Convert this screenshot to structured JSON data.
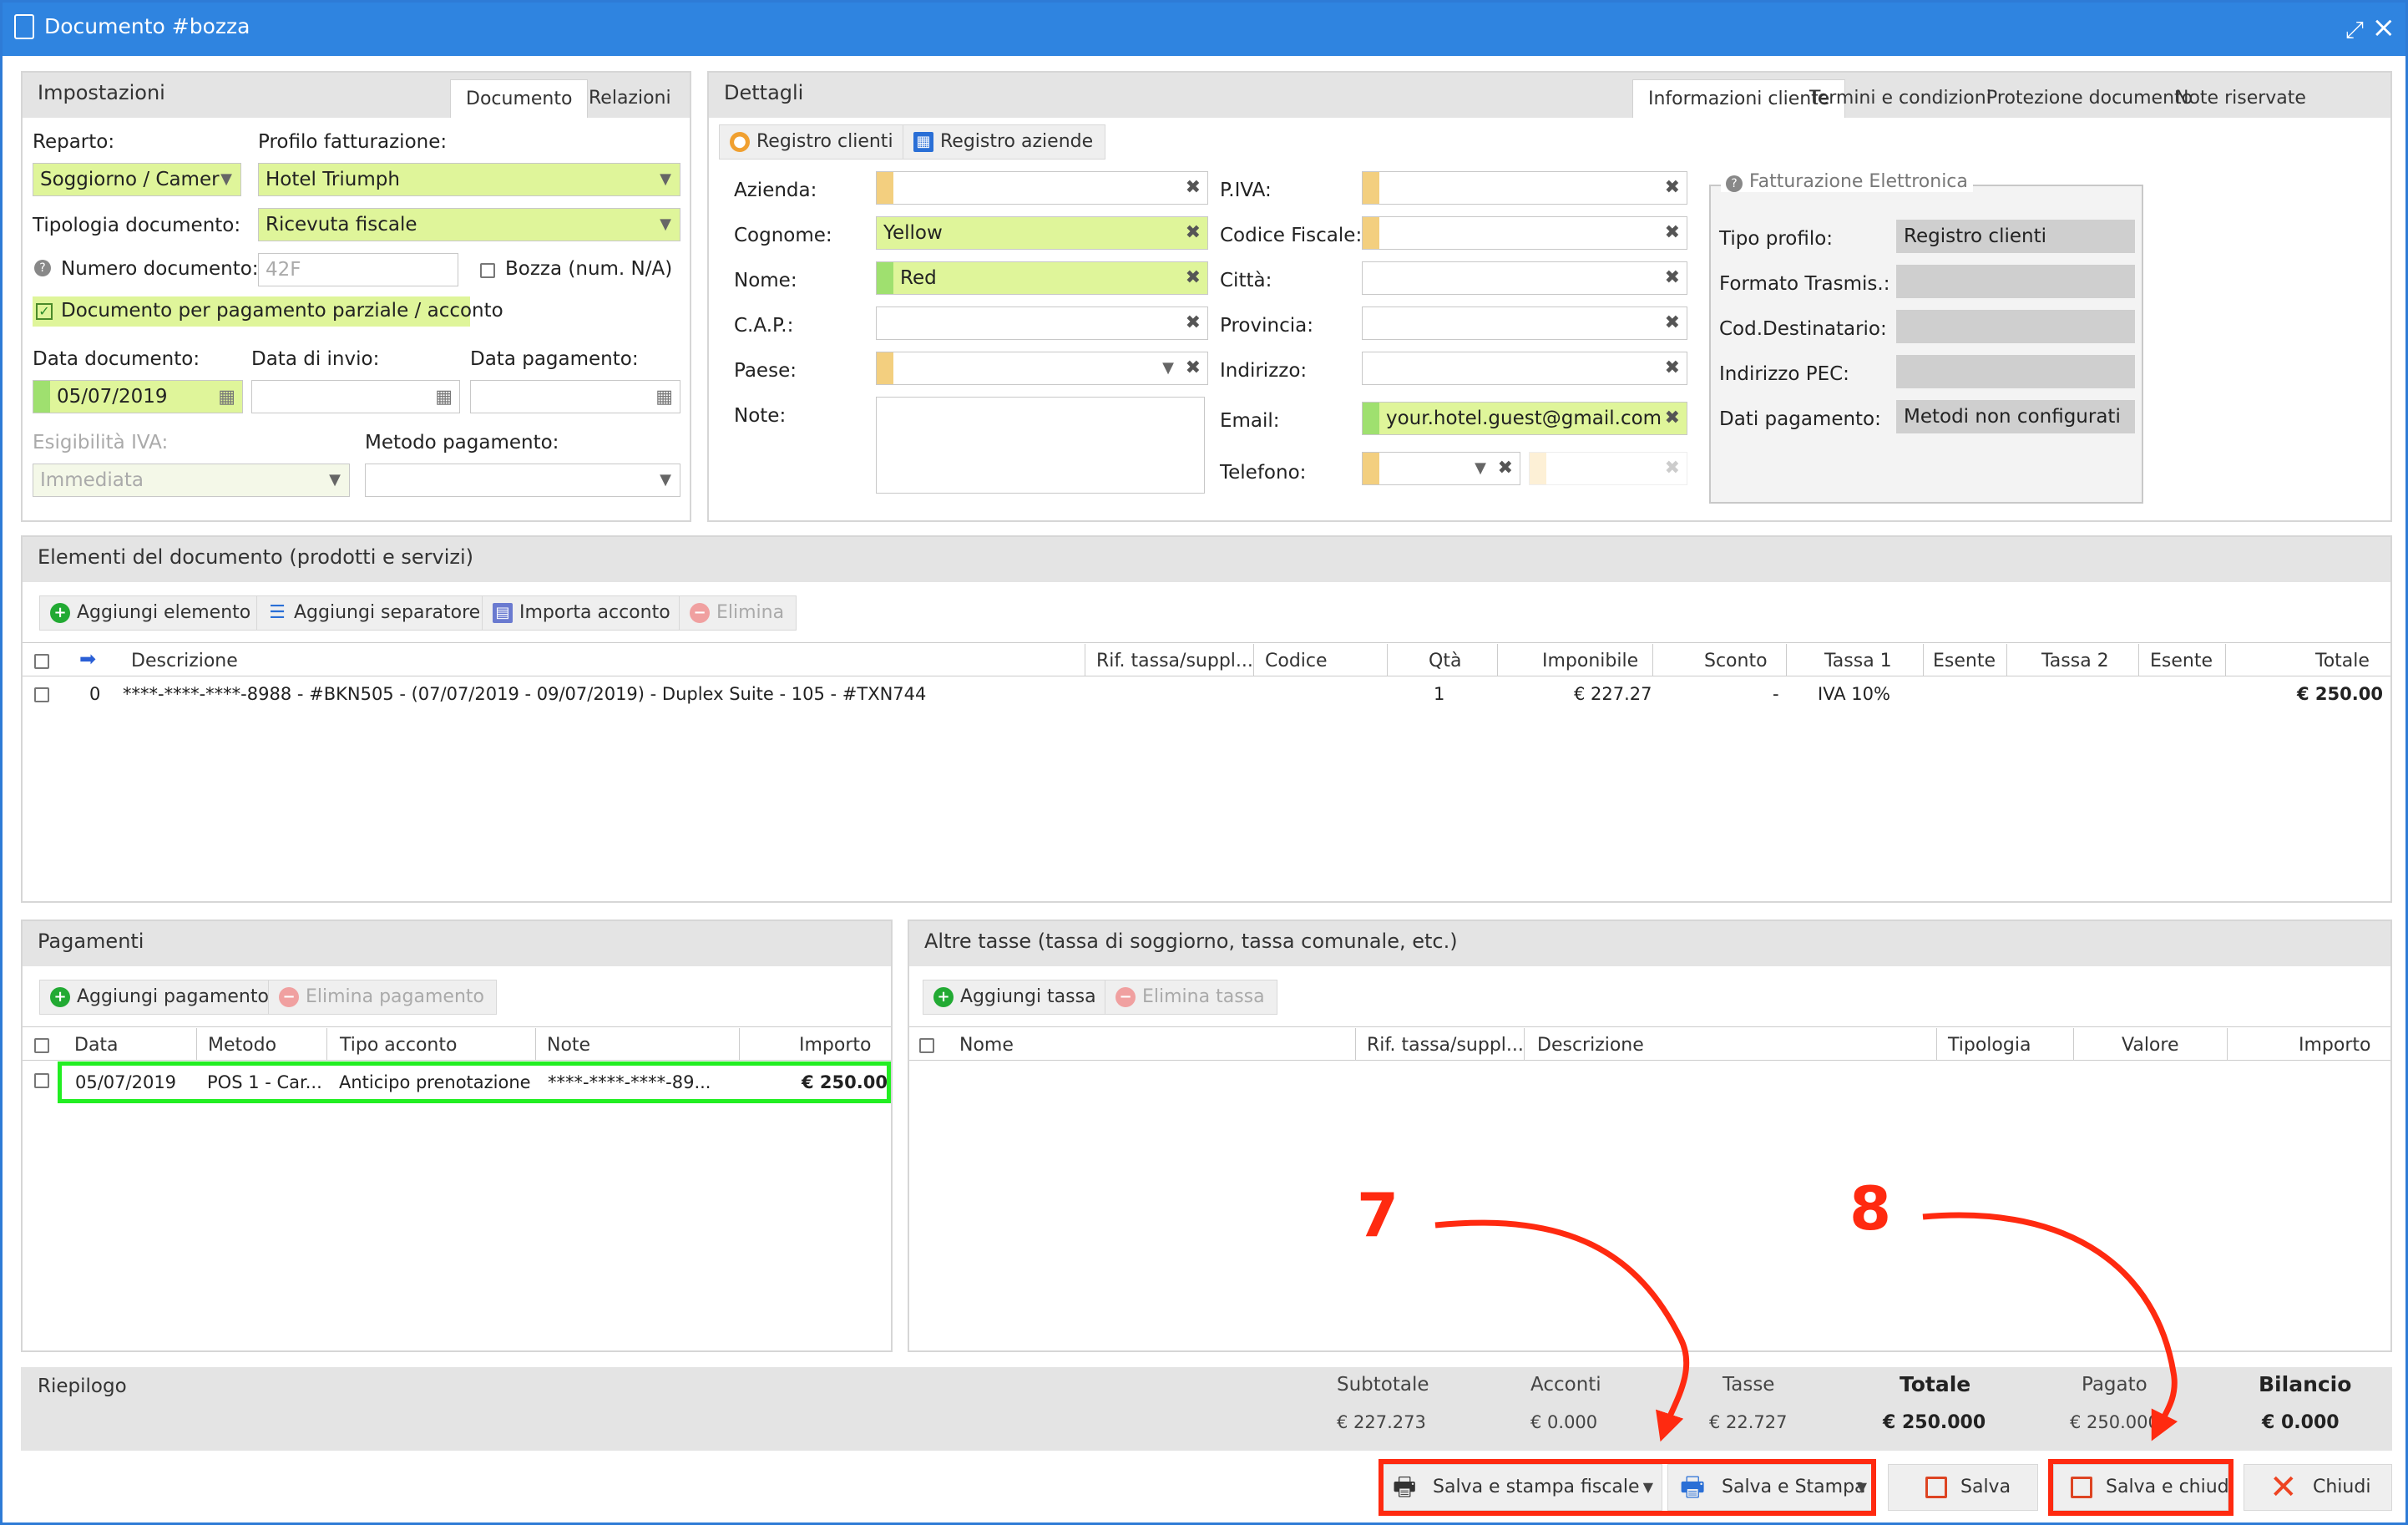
{
  "window": {
    "title": "Documento #bozza"
  },
  "impostazioni": {
    "title": "Impostazioni",
    "tabs": [
      "Documento",
      "Relazioni"
    ],
    "reparto_label": "Reparto:",
    "reparto_value": "Soggiorno / Camer",
    "profilo_label": "Profilo fatturazione:",
    "profilo_value": "Hotel Triumph",
    "tipologia_label": "Tipologia documento:",
    "tipologia_value": "Ricevuta fiscale",
    "numero_label": "Numero documento:",
    "numero_placeholder": "42F",
    "bozza_label": "Bozza (num. N/A)",
    "parziale_label": "Documento per pagamento parziale / acconto",
    "data_doc_label": "Data documento:",
    "data_doc_value": "05/07/2019",
    "data_invio_label": "Data di invio:",
    "data_pag_label": "Data pagamento:",
    "esig_label": "Esigibilità IVA:",
    "esig_value": "Immediata",
    "metodo_label": "Metodo pagamento:"
  },
  "dettagli": {
    "title": "Dettagli",
    "tabs": [
      "Informazioni cliente",
      "Termini e condizioni",
      "Protezione documento",
      "Note riservate"
    ],
    "btn_clienti": "Registro clienti",
    "btn_aziende": "Registro aziende",
    "azienda": "Azienda:",
    "cognome": "Cognome:",
    "cognome_value": "Yellow",
    "nome": "Nome:",
    "nome_value": "Red",
    "cap": "C.A.P.:",
    "paese": "Paese:",
    "note": "Note:",
    "piva": "P.IVA:",
    "cf": "Codice Fiscale:",
    "citta": "Città:",
    "provincia": "Provincia:",
    "indirizzo": "Indirizzo:",
    "email": "Email:",
    "email_value": "your.hotel.guest@gmail.com",
    "telefono": "Telefono:"
  },
  "fe": {
    "title": "Fatturazione Elettronica",
    "tipo_label": "Tipo profilo:",
    "tipo_value": "Registro clienti",
    "formato_label": "Formato Trasmis.:",
    "cod_label": "Cod.Destinatario:",
    "pec_label": "Indirizzo PEC:",
    "dati_label": "Dati pagamento:",
    "dati_value": "Metodi non configurati"
  },
  "elementi": {
    "title": "Elementi del documento (prodotti e servizi)",
    "btn_add": "Aggiungi elemento",
    "btn_sep": "Aggiungi separatore",
    "btn_import": "Importa acconto",
    "btn_del": "Elimina",
    "headers": [
      "Descrizione",
      "Rif. tassa/suppl...",
      "Codice",
      "Qtà",
      "Imponibile",
      "Sconto",
      "Tassa 1",
      "Esente",
      "Tassa 2",
      "Esente",
      "Totale"
    ],
    "row": {
      "idx": "0",
      "descr": "****-****-****-8988 - #BKN505 - (07/07/2019 - 09/07/2019) - Duplex Suite - 105 - #TXN744",
      "qta": "1",
      "imponibile": "€ 227.27",
      "sconto": "-",
      "tassa1": "IVA 10%",
      "totale": "€ 250.00"
    }
  },
  "pagamenti": {
    "title": "Pagamenti",
    "btn_add": "Aggiungi pagamento",
    "btn_del": "Elimina pagamento",
    "headers": [
      "Data",
      "Metodo",
      "Tipo acconto",
      "Note",
      "Importo"
    ],
    "row": {
      "data": "05/07/2019",
      "metodo": "POS 1 - Car...",
      "tipo": "Anticipo prenotazione",
      "note": "****-****-****-89...",
      "importo": "€ 250.00"
    }
  },
  "tasse": {
    "title": "Altre tasse (tassa di soggiorno, tassa comunale, etc.)",
    "btn_add": "Aggiungi tassa",
    "btn_del": "Elimina tassa",
    "headers": [
      "Nome",
      "Rif. tassa/suppl...",
      "Descrizione",
      "Tipologia",
      "Valore",
      "Importo"
    ]
  },
  "riepilogo": {
    "title": "Riepilogo",
    "labels": [
      "Subtotale",
      "Acconti",
      "Tasse",
      "Totale",
      "Pagato",
      "Bilancio"
    ],
    "values": [
      "€ 227.273",
      "€ 0.000",
      "€ 22.727",
      "€ 250.000",
      "€ 250.000",
      "€ 0.000"
    ]
  },
  "footer": {
    "stampa_fiscale": "Salva e stampa fiscale",
    "stampa": "Salva e Stampa",
    "salva": "Salva",
    "salva_chiudi": "Salva e chiudi",
    "chiudi": "Chiudi"
  },
  "annotations": {
    "n7": "7",
    "n8": "8"
  },
  "colors": {
    "titlebar": "#2f84e0",
    "field_green": "#dff59a",
    "annotation_red": "#ff2a10",
    "highlight_green": "#22ee22"
  }
}
